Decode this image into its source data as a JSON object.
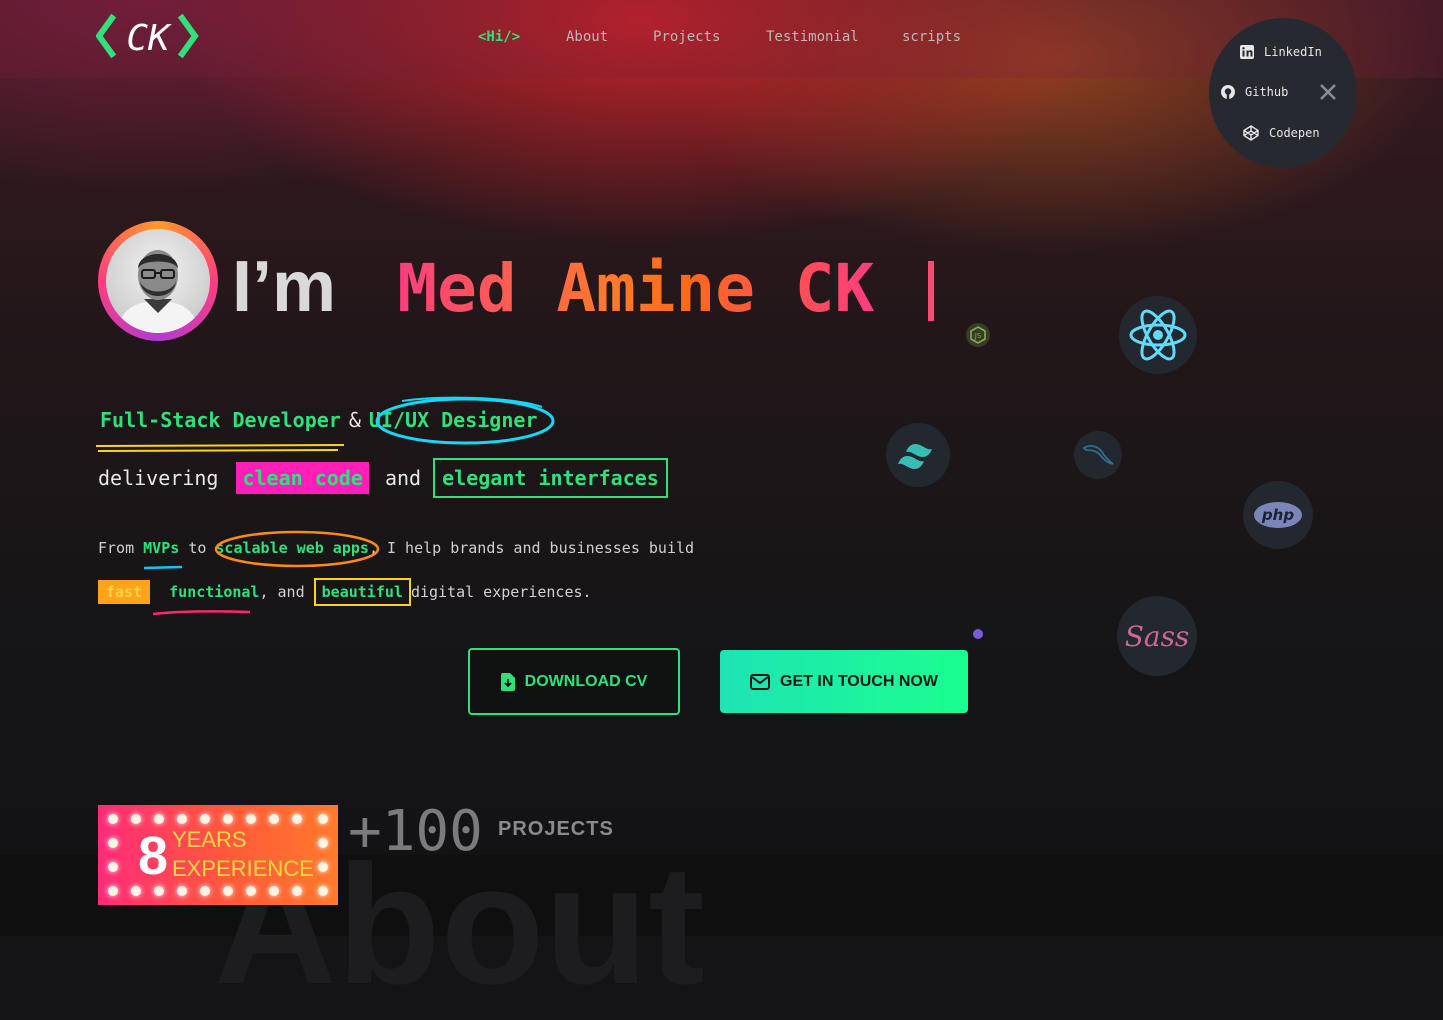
{
  "logo": {
    "text": "CK"
  },
  "nav": {
    "items": [
      {
        "label": "<Hi/>",
        "active": true
      },
      {
        "label": "About"
      },
      {
        "label": "Projects"
      },
      {
        "label": "Testimonial"
      },
      {
        "label": "scripts"
      }
    ]
  },
  "social": {
    "items": [
      {
        "label": "LinkedIn",
        "icon": "linkedin-icon"
      },
      {
        "label": "Github",
        "icon": "github-icon"
      },
      {
        "label": "Codepen",
        "icon": "codepen-icon"
      }
    ],
    "close_icon": "close-icon"
  },
  "hero": {
    "im": "I’m",
    "name": "Med Amine CK"
  },
  "tagline": {
    "role1": "Full-Stack Developer",
    "amp": "&",
    "role2": "UI/UX Designer",
    "delivering": "delivering",
    "clean_code": "clean code",
    "and": "and",
    "elegant": "elegant interfaces"
  },
  "description": {
    "from": "From",
    "mvps": "MVPs",
    "to": "to",
    "scalable": "scalable web apps",
    "rest": ", I help brands and businesses build",
    "fast": "fast",
    "functional": "functional",
    "comma_and": ", and",
    "beautiful": "beautiful",
    "digital": "digital experiences."
  },
  "buttons": {
    "cv": "DOWNLOAD CV",
    "touch": "GET IN TOUCH NOW"
  },
  "tech_icons": [
    "nodejs-icon",
    "react-icon",
    "tailwind-icon",
    "mysql-icon",
    "php-icon",
    "sass-icon"
  ],
  "tech_labels": {
    "php": "php",
    "sass": "Sass"
  },
  "experience": {
    "years": "8",
    "line1": "YEARS",
    "line2": "EXPERIENCE"
  },
  "projects": {
    "count": "+100",
    "label": "PROJECTS"
  },
  "watermark": "About",
  "colors": {
    "accent_green": "#2fe07b",
    "accent_pink": "#ff3d7f",
    "accent_orange": "#ff7a2a",
    "highlight_magenta": "#ff1fb7",
    "highlight_yellow": "#ffd21a"
  }
}
